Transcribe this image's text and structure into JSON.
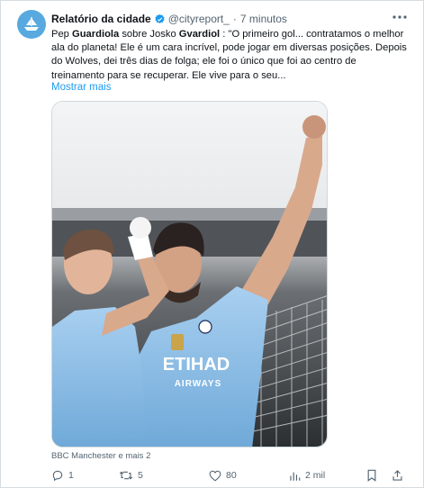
{
  "tweet": {
    "author_name": "Relatório da cidade",
    "handle": "@cityreport_",
    "separator": "·",
    "time": "7 minutos",
    "text_parts": {
      "p1": "Pep ",
      "b1": "Guardiola",
      "p2": " sobre Josko ",
      "b2": "Gvardiol",
      "p3": " : \"O primeiro gol... contratamos o melhor ala do planeta! Ele é um cara incrível, pode jogar em diversas posições. Depois do Wolves, dei três dias de folga; ele foi o único que foi ao centro de treinamento para se recuperar. Ele vive para o seu..."
    },
    "show_more": "Mostrar mais",
    "media": {
      "sponsor_text": "ETIHAD",
      "sponsor_sub": "AIRWAYS",
      "description_icon": "photo"
    },
    "source": "BBC Manchester e mais 2",
    "actions": {
      "replies": "1",
      "retweets": "5",
      "likes": "80",
      "views": "2 mil"
    }
  },
  "icons": {
    "verified": "verified-badge-icon",
    "more": "more-options-icon",
    "reply": "reply-icon",
    "retweet": "retweet-icon",
    "like": "heart-icon",
    "views": "views-chart-icon",
    "bookmark": "bookmark-icon",
    "share": "share-icon"
  },
  "colors": {
    "accent": "#1d9bf0",
    "muted": "#536471",
    "city_blue": "#6cabdd"
  }
}
